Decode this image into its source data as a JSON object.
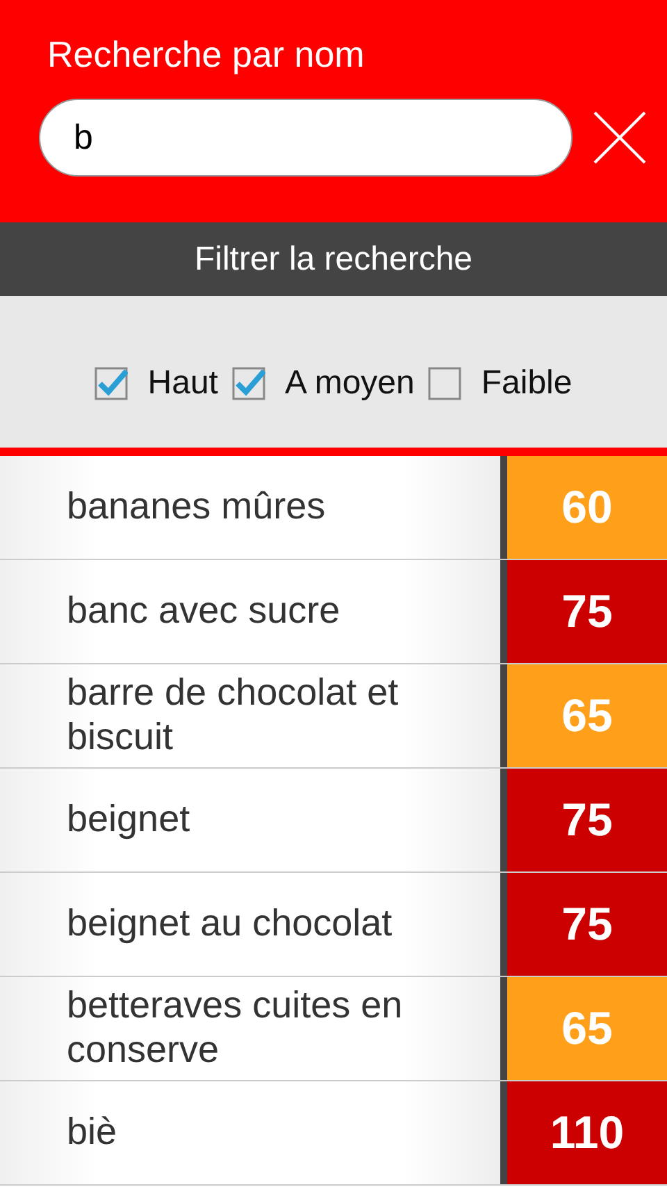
{
  "header": {
    "title": "Recherche par nom",
    "search": {
      "value": "b"
    }
  },
  "filter": {
    "title": "Filtrer la recherche",
    "options": [
      {
        "label": "Haut",
        "checked": true
      },
      {
        "label": "A moyen",
        "checked": true
      },
      {
        "label": "Faible",
        "checked": false
      }
    ]
  },
  "results": [
    {
      "name": "bananes mûres",
      "score": "60",
      "color": "#ff9f1a"
    },
    {
      "name": "banc avec sucre",
      "score": "75",
      "color": "#cc0000"
    },
    {
      "name": "barre de chocolat et biscuit",
      "score": "65",
      "color": "#ff9f1a"
    },
    {
      "name": "beignet",
      "score": "75",
      "color": "#cc0000"
    },
    {
      "name": "beignet au chocolat",
      "score": "75",
      "color": "#cc0000"
    },
    {
      "name": "betteraves cuites en conserve",
      "score": "65",
      "color": "#ff9f1a"
    },
    {
      "name": "biè",
      "score": "110",
      "color": "#cc0000"
    }
  ]
}
